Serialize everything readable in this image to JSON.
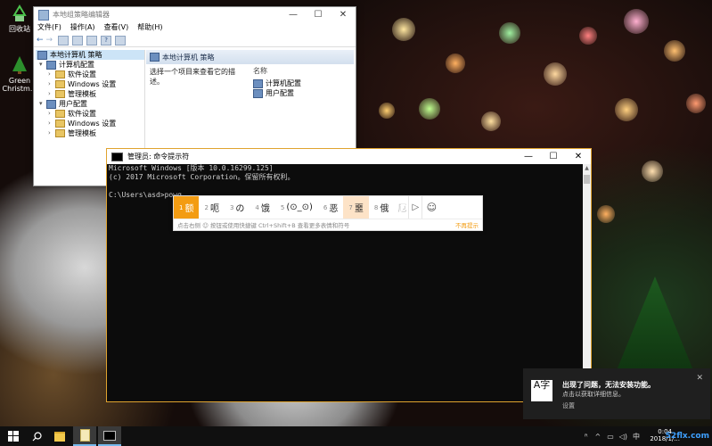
{
  "desktop": {
    "icons": [
      {
        "label": "回收站",
        "icon": "recycle-bin-icon"
      },
      {
        "label": "Green Christm...",
        "icon": "christmas-tree-icon"
      }
    ]
  },
  "gpedit": {
    "title": "本地组策略编辑器",
    "menu": [
      "文件(F)",
      "操作(A)",
      "查看(V)",
      "帮助(H)"
    ],
    "tree": {
      "root": "本地计算机 策略",
      "computer_config": "计算机配置",
      "user_config": "用户配置",
      "computer_children": [
        "软件设置",
        "Windows 设置",
        "管理模板"
      ],
      "user_children": [
        "软件设置",
        "Windows 设置",
        "管理模板"
      ]
    },
    "right": {
      "header": "本地计算机 策略",
      "description": "选择一个项目来查看它的描述。",
      "column": "名称",
      "items": [
        "计算机配置",
        "用户配置"
      ]
    }
  },
  "cmd": {
    "title": "管理员: 命令提示符",
    "lines": [
      "Microsoft Windows [版本 10.0.16299.125]",
      "(c) 2017 Microsoft Corporation。保留所有权利。",
      "",
      "C:\\Users\\asd>powg"
    ]
  },
  "ime": {
    "candidates": [
      {
        "n": "1",
        "text": "额"
      },
      {
        "n": "2",
        "text": "呃"
      },
      {
        "n": "3",
        "text": "の"
      },
      {
        "n": "4",
        "text": "饿"
      },
      {
        "n": "5",
        "text": "(⊙_⊙)"
      },
      {
        "n": "6",
        "text": "恶"
      },
      {
        "n": "7",
        "text": "噩"
      },
      {
        "n": "8",
        "text": "俄"
      },
      {
        "n": "",
        "text": "厄"
      }
    ],
    "hint": "点击右侧 ☺ 按钮或使用快捷键 Ctrl+Shift+B 查看更多表情和符号",
    "stop": "不再提示",
    "accent": "#f39c12"
  },
  "toast": {
    "badge": "A字",
    "title": "出现了问题，无法安装功能。",
    "body": "点击以获取详细信息。",
    "footer": "设置"
  },
  "taskbar": {
    "time": "0:04",
    "date": "2018/1/...",
    "watermark": "52flx.com"
  }
}
